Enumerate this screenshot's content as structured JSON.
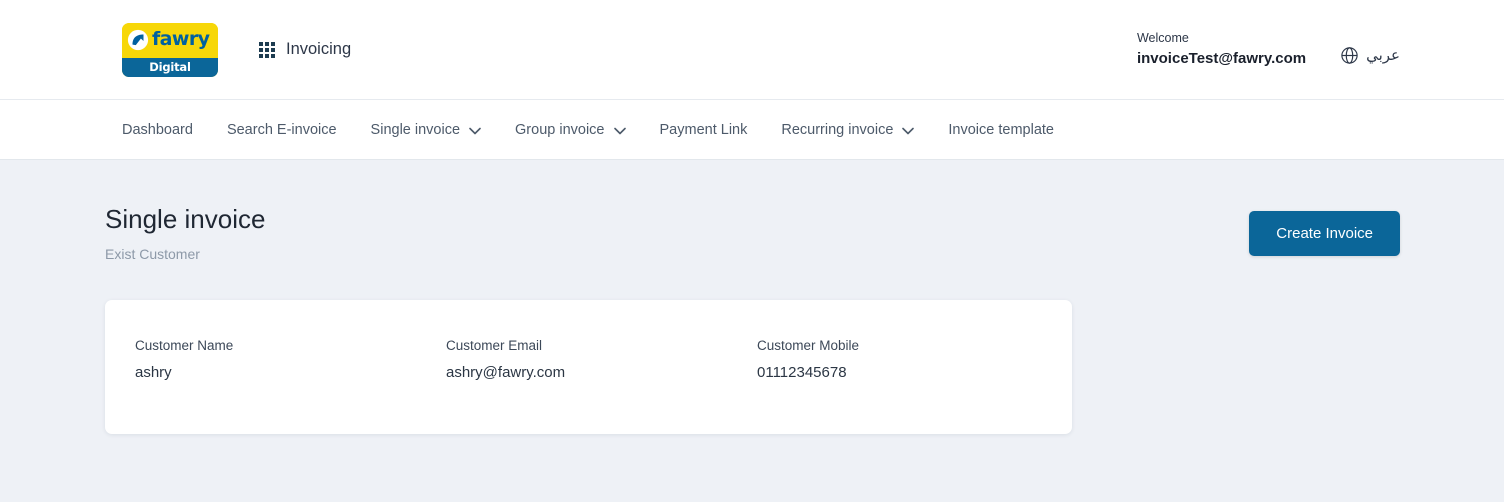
{
  "header": {
    "logo": {
      "brand": "fawry",
      "sub": "Digital",
      "mark_icon": "fawry-arrow-mark",
      "yellow": "#f7d708",
      "blue": "#0b6699"
    },
    "apps_icon": "grid-apps-icon",
    "app_name": "Invoicing",
    "welcome_label": "Welcome",
    "user_email": "invoiceTest@fawry.com",
    "language": {
      "icon": "globe-icon",
      "label": "عربي"
    }
  },
  "nav": {
    "items": [
      {
        "label": "Dashboard",
        "has_caret": false
      },
      {
        "label": "Search E-invoice",
        "has_caret": false
      },
      {
        "label": "Single invoice",
        "has_caret": true
      },
      {
        "label": "Group invoice",
        "has_caret": true
      },
      {
        "label": "Payment Link",
        "has_caret": false
      },
      {
        "label": "Recurring invoice",
        "has_caret": true
      },
      {
        "label": "Invoice template",
        "has_caret": false
      }
    ],
    "caret_icon": "chevron-down-icon"
  },
  "main": {
    "title": "Single invoice",
    "subtitle": "Exist Customer",
    "create_button": "Create Invoice",
    "accent_color": "#0b6699",
    "customer": {
      "fields": [
        {
          "label": "Customer Name",
          "value": "ashry"
        },
        {
          "label": "Customer Email",
          "value": "ashry@fawry.com"
        },
        {
          "label": "Customer Mobile",
          "value": "01112345678"
        }
      ]
    }
  }
}
